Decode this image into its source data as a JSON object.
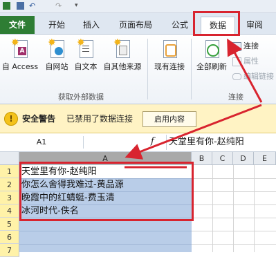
{
  "tabs": {
    "file": "文件",
    "home": "开始",
    "insert": "插入",
    "page_layout": "页面布局",
    "formulas": "公式",
    "data": "数据",
    "review": "审阅"
  },
  "ribbon": {
    "get_external": {
      "access": "自 Access",
      "web": "自网站",
      "text": "自文本",
      "other": "自其他来源",
      "existing": "现有连接",
      "group_label": "获取外部数据"
    },
    "connections": {
      "refresh_all": "全部刷新",
      "connections": "连接",
      "properties": "属性",
      "edit_links": "编辑链接",
      "group_label": "连接"
    }
  },
  "security": {
    "title": "安全警告",
    "message": "已禁用了数据连接",
    "button": "启用内容"
  },
  "formula_bar": {
    "name_box": "A1",
    "fx": "f",
    "content": "天堂里有你-赵纯阳"
  },
  "sheet": {
    "columns": [
      "A",
      "B",
      "C",
      "D",
      "E"
    ],
    "rows": [
      "1",
      "2",
      "3",
      "4",
      "5",
      "6",
      "7"
    ],
    "cells": [
      "天堂里有你-赵纯阳",
      "你怎么舍得我难过-黄品源",
      "晚霞中的红蜻蜓-费玉清",
      "冰河时代-佚名"
    ]
  },
  "colors": {
    "file_tab": "#2e7d34",
    "annotation": "#d8242f",
    "selection": "#b9cde8",
    "warning_bar": "#fff3c4"
  }
}
